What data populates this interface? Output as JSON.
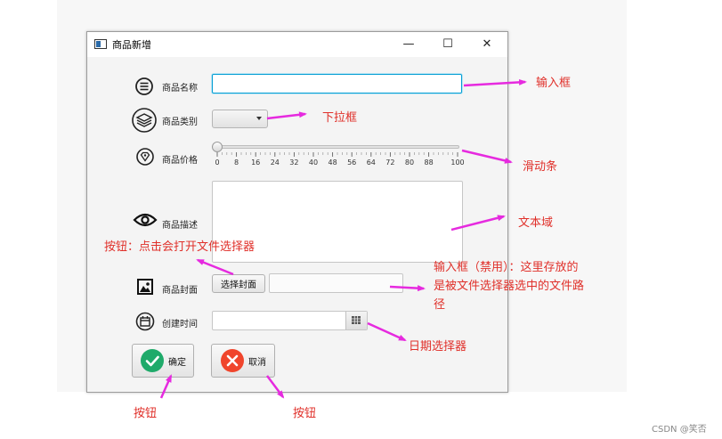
{
  "window": {
    "title": "商品新增",
    "controls": {
      "minimize": "—",
      "maximize": "☐",
      "close": "✕"
    }
  },
  "form": {
    "name_label": "商品名称",
    "name_value": "",
    "category_label": "商品类别",
    "category_selected": "",
    "price_label": "商品价格",
    "price_slider": {
      "value": 0,
      "min": 0,
      "max": 100,
      "ticks": [
        "0",
        "8",
        "16",
        "24",
        "32",
        "40",
        "48",
        "56",
        "64",
        "72",
        "80",
        "88",
        "100"
      ]
    },
    "desc_label": "商品描述",
    "desc_value": "",
    "cover_label": "商品封面",
    "cover_button": "选择封面",
    "cover_path": "",
    "date_label": "创建时间",
    "date_value": "",
    "ok_button": "确定",
    "cancel_button": "取消"
  },
  "annotations": {
    "input_box": "输入框",
    "dropdown": "下拉框",
    "slider": "滑动条",
    "text_area": "文本域",
    "file_button": "按钮：点击会打开文件选择器",
    "disabled_input_line1": "输入框（禁用）：这里存放的",
    "disabled_input_line2": "是被文件选择器选中的文件路",
    "disabled_input_line3": "径",
    "date_picker": "日期选择器",
    "ok_note": "按钮",
    "cancel_note": "按钮"
  },
  "colors": {
    "annotation_text": "#e0302a",
    "arrow": "#e62adf",
    "ok_icon": "#1faa6a",
    "cancel_icon": "#f0452c",
    "focus_border": "#039ed3"
  },
  "watermark": "CSDN @笑否"
}
